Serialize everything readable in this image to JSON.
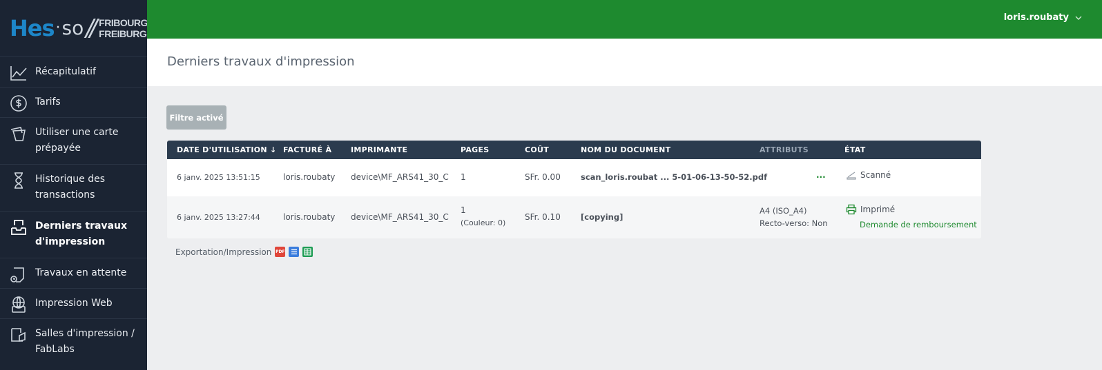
{
  "brand": {
    "hes": "Hes",
    "dot": "·",
    "so": "so",
    "slash": "//",
    "city1": "FRIBOURG",
    "city2": "FREIBURG"
  },
  "sidebar": {
    "items": [
      {
        "label": "Récapitulatif",
        "icon": "chart-line-icon"
      },
      {
        "label": "Tarifs",
        "icon": "dollar-circle-icon"
      },
      {
        "label": "Utiliser une carte prépayée",
        "icon": "cards-icon"
      },
      {
        "label": "Historique des transactions",
        "icon": "hourglass-icon"
      },
      {
        "label": "Derniers travaux d'impression",
        "icon": "inbox-tray-icon"
      },
      {
        "label": "Travaux en attente",
        "icon": "document-clock-icon"
      },
      {
        "label": "Impression Web",
        "icon": "globe-printer-icon"
      },
      {
        "label": "Salles d'impression / FabLabs",
        "icon": "room-icon"
      }
    ]
  },
  "header": {
    "user": "loris.roubaty",
    "bg_color": "#1e8a2f"
  },
  "page": {
    "title": "Derniers travaux d'impression",
    "filter_label": "Filtre activé"
  },
  "table": {
    "columns": {
      "date": "DATE D'UTILISATION ↓",
      "billed": "FACTURÉ À",
      "printer": "IMPRIMANTE",
      "pages": "PAGES",
      "cost": "COÛT",
      "doc": "NOM DU DOCUMENT",
      "attrs": "ATTRIBUTS",
      "state": "ÉTAT"
    },
    "rows": [
      {
        "date": "6 janv. 2025 13:51:15",
        "billed": "loris.roubaty",
        "printer": "device\\MF_ARS41_30_C",
        "pages": "1",
        "pages_sub": "",
        "cost": "SFr. 0.00",
        "doc": "scan_loris.roubat ... 5-01-06-13-50-52.pdf",
        "attr1": "",
        "attr2": "",
        "more": "...",
        "state": "Scanné",
        "state_icon": "scanner-icon",
        "refund": ""
      },
      {
        "date": "6 janv. 2025 13:27:44",
        "billed": "loris.roubaty",
        "printer": "device\\MF_ARS41_30_C",
        "pages": "1",
        "pages_sub": "(Couleur: 0)",
        "cost": "SFr. 0.10",
        "doc": "[copying]",
        "attr1": "A4 (ISO_A4)",
        "attr2": "Recto-verso: Non",
        "more": "...",
        "state": "Imprimé",
        "state_icon": "printer-icon",
        "refund": "Demande de remboursement"
      }
    ]
  },
  "export": {
    "label": "Exportation/Impression",
    "icons": [
      "pdf-icon",
      "list-icon",
      "spreadsheet-icon"
    ]
  }
}
